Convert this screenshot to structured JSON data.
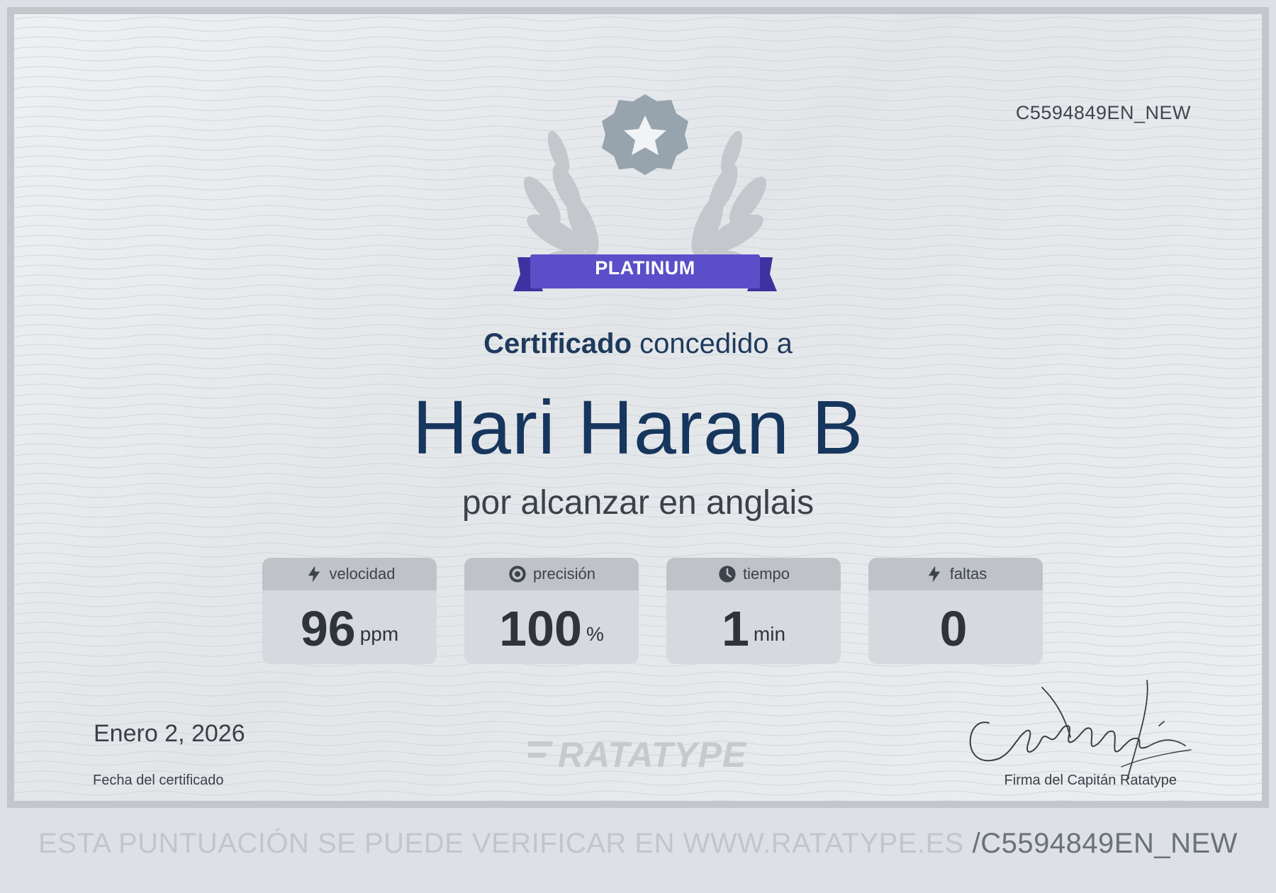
{
  "certificate": {
    "id": "C5594849EN_NEW",
    "badge_label": "PLATINUM",
    "heading_strong": "Certificado",
    "heading_rest": " concedido a",
    "recipient_name": "Hari Haran B",
    "achievement": "por alcanzar en anglais"
  },
  "stats": [
    {
      "icon": "lightning-icon",
      "label": "velocidad",
      "value": "96",
      "unit": "ppm"
    },
    {
      "icon": "target-icon",
      "label": "precisión",
      "value": "100",
      "unit": "%"
    },
    {
      "icon": "clock-icon",
      "label": "tiempo",
      "value": "1",
      "unit": "min"
    },
    {
      "icon": "lightning-icon",
      "label": "faltas",
      "value": "0",
      "unit": ""
    }
  ],
  "footer": {
    "date": "Enero 2, 2026",
    "date_label": "Fecha del certificado",
    "brand": "RATATYPE",
    "signature_label": "Firma del Capitán Ratatype"
  },
  "verify": {
    "text": "ESTA PUNTUACIÓN SE PUEDE VERIFICAR EN WWW.RATATYPE.ES",
    "code": " /C5594849EN_NEW"
  },
  "colors": {
    "badge": "#5a4fc9",
    "badge_dark": "#3d33a0",
    "emblem": "#bfc3c7",
    "emblem_star_badge": "#97a3ad",
    "name": "#16365d"
  }
}
